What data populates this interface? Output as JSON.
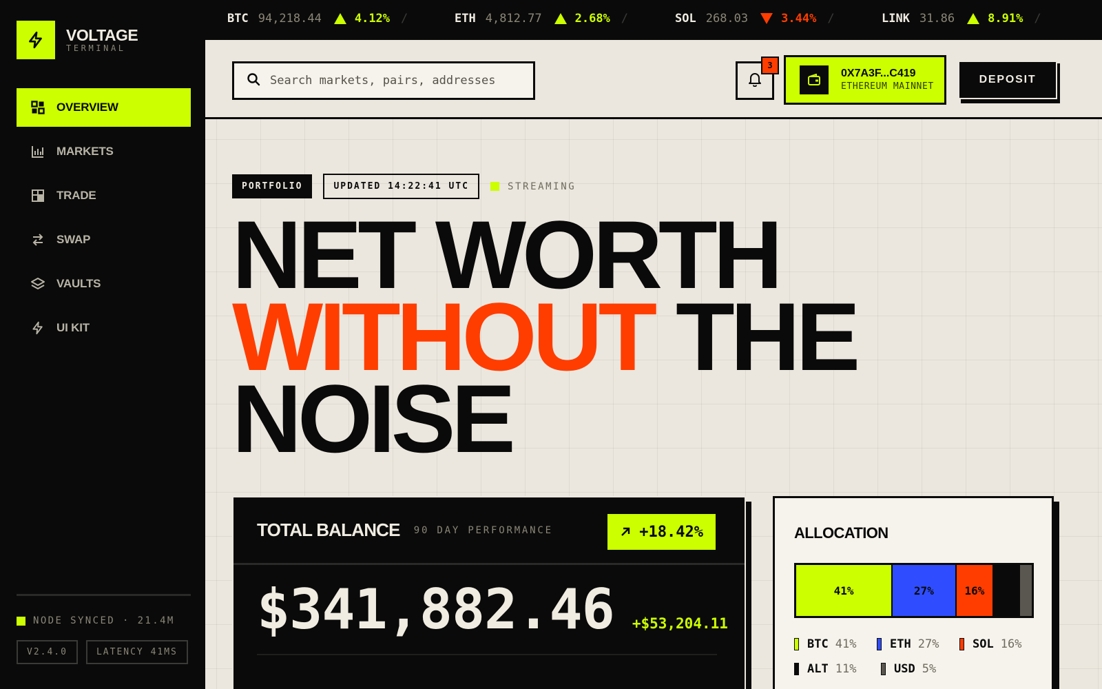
{
  "brand": {
    "name": "VOLTAGE",
    "subtitle": "TERMINAL",
    "icon": "bolt-icon",
    "accent": "#ccff00"
  },
  "ticker": [
    {
      "symbol": "BTC",
      "price": "94,218.44",
      "change": "4.12%",
      "direction": "up"
    },
    {
      "symbol": "ETH",
      "price": "4,812.77",
      "change": "2.68%",
      "direction": "up"
    },
    {
      "symbol": "SOL",
      "price": "268.03",
      "change": "3.44%",
      "direction": "down"
    },
    {
      "symbol": "LINK",
      "price": "31.86",
      "change": "8.91%",
      "direction": "up"
    }
  ],
  "ticker_separator": "/",
  "nav": {
    "items": [
      {
        "label": "OVERVIEW",
        "icon": "grid-icon",
        "active": true
      },
      {
        "label": "MARKETS",
        "icon": "bar-chart-icon"
      },
      {
        "label": "TRADE",
        "icon": "layout-icon"
      },
      {
        "label": "SWAP",
        "icon": "swap-arrows-icon"
      },
      {
        "label": "VAULTS",
        "icon": "layers-icon"
      },
      {
        "label": "UI KIT",
        "icon": "bolt-icon"
      }
    ]
  },
  "sidebar_footer": {
    "status": "NODE SYNCED · 21.4M",
    "version": "V2.4.0",
    "latency": "LATENCY 41MS"
  },
  "search": {
    "placeholder": "Search markets, pairs, addresses",
    "value": ""
  },
  "notifications": {
    "count": "3",
    "icon": "bell-icon"
  },
  "wallet": {
    "address": "0X7A3F...C419",
    "network": "ETHEREUM MAINNET",
    "icon": "wallet-icon"
  },
  "actions": {
    "deposit_label": "DEPOSIT"
  },
  "tags": {
    "section": "PORTFOLIO",
    "updated": "UPDATED 14:22:41 UTC",
    "stream": "STREAMING"
  },
  "headline": {
    "line1": "NET WORTH",
    "line2_accent": "WITHOUT",
    "line2_rest": "THE",
    "line3": "NOISE"
  },
  "balance": {
    "title": "TOTAL BALANCE",
    "subtitle": "90 DAY PERFORMANCE",
    "performance": "+18.42%",
    "value": "$341,882.46",
    "delta": "+$53,204.11"
  },
  "allocation": {
    "title": "ALLOCATION",
    "segments": [
      {
        "name": "BTC",
        "percent": 41,
        "label": "41%",
        "color": "#ccff00"
      },
      {
        "name": "ETH",
        "percent": 27,
        "label": "27%",
        "color": "#2f4dff"
      },
      {
        "name": "SOL",
        "percent": 16,
        "label": "16%",
        "color": "#ff3d00"
      },
      {
        "name": "ALT",
        "percent": 11,
        "label": "11%",
        "color": "#0a0a0a"
      },
      {
        "name": "USD",
        "percent": 5,
        "label": "5%",
        "color": "#5a5750"
      }
    ]
  },
  "colors": {
    "accent": "#ccff00",
    "alert": "#ff3d00",
    "ink": "#0a0a0a",
    "paper": "#ebe7de"
  }
}
